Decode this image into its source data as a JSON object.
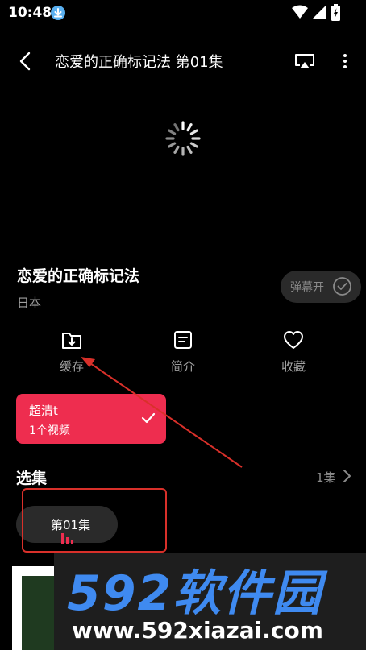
{
  "status": {
    "time": "10:48"
  },
  "header": {
    "title": "恋爱的正确标记法 第01集"
  },
  "info": {
    "name": "恋爱的正确标记法",
    "region": "日本",
    "danmu_label": "弹幕开"
  },
  "actions": [
    {
      "label": "缓存",
      "icon": "download-folder-icon"
    },
    {
      "label": "简介",
      "icon": "document-icon"
    },
    {
      "label": "收藏",
      "icon": "heart-icon"
    }
  ],
  "quality": {
    "name": "超清t",
    "count": "1个视频"
  },
  "episodes": {
    "title": "选集",
    "count": "1集",
    "items": [
      {
        "label": "第01集",
        "playing": true
      }
    ]
  },
  "watermark": {
    "logo": "592软件园",
    "url": "www.592xiazai.com"
  },
  "colors": {
    "accent": "#ee2d4f",
    "annotation": "#d9302a",
    "watermark_blue": "#3f8af0"
  }
}
